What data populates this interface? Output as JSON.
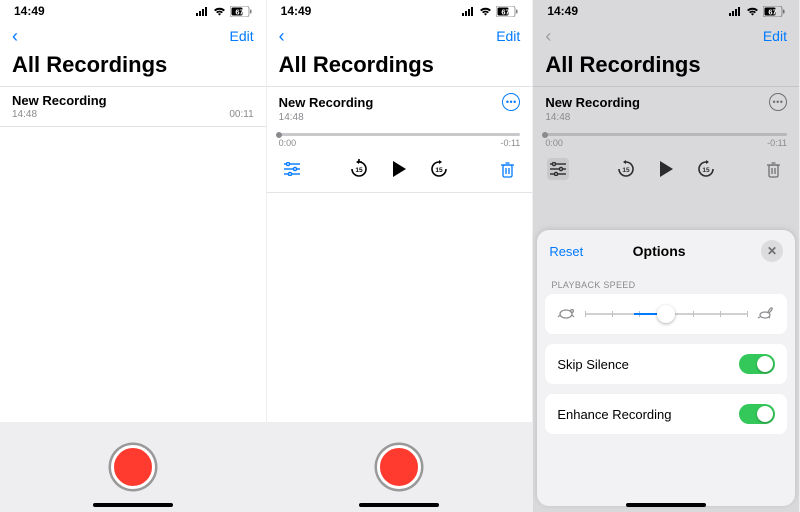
{
  "status": {
    "time": "14:49",
    "battery": "67"
  },
  "nav": {
    "edit": "Edit"
  },
  "title": "All Recordings",
  "screen1": {
    "rec": {
      "name": "New Recording",
      "timestamp": "14:48",
      "duration": "00:11"
    }
  },
  "screen2": {
    "rec": {
      "name": "New Recording",
      "timestamp": "14:48"
    },
    "scrub": {
      "start": "0:00",
      "end": "-0:11"
    }
  },
  "screen3": {
    "rec": {
      "name": "New Recording",
      "timestamp": "14:48"
    },
    "scrub": {
      "start": "0:00",
      "end": "-0:11"
    }
  },
  "sheet": {
    "reset": "Reset",
    "title": "Options",
    "speed_label": "PLAYBACK SPEED",
    "skip_silence": "Skip Silence",
    "enhance": "Enhance Recording"
  }
}
